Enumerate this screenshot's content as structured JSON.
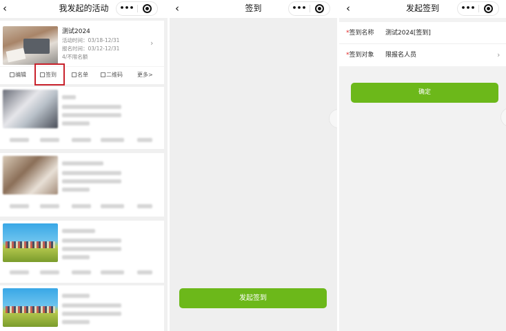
{
  "panel1": {
    "title": "我发起的活动",
    "back_icon": "chevron-left-icon",
    "card": {
      "title": "测试2024",
      "activity_time": "活动时间：03/18-12/31",
      "signup_time": "报名时间：03/12-12/31",
      "quota": "4/不限名额"
    },
    "actions": {
      "edit": "编辑",
      "checkin": "签到",
      "list": "名单",
      "qrcode": "二维码",
      "more": "更多>"
    }
  },
  "panel2": {
    "title": "签到",
    "start_button": "发起签到"
  },
  "panel3": {
    "title": "发起签到",
    "required_mark": "*",
    "name_label": "签到名称",
    "name_value": "测试2024[签到]",
    "target_label": "签到对象",
    "target_value": "限报名人员",
    "confirm_button": "确定"
  },
  "colors": {
    "primary_green": "#6cb81a",
    "highlight_red": "#c8202a",
    "required_red": "#e02424"
  }
}
